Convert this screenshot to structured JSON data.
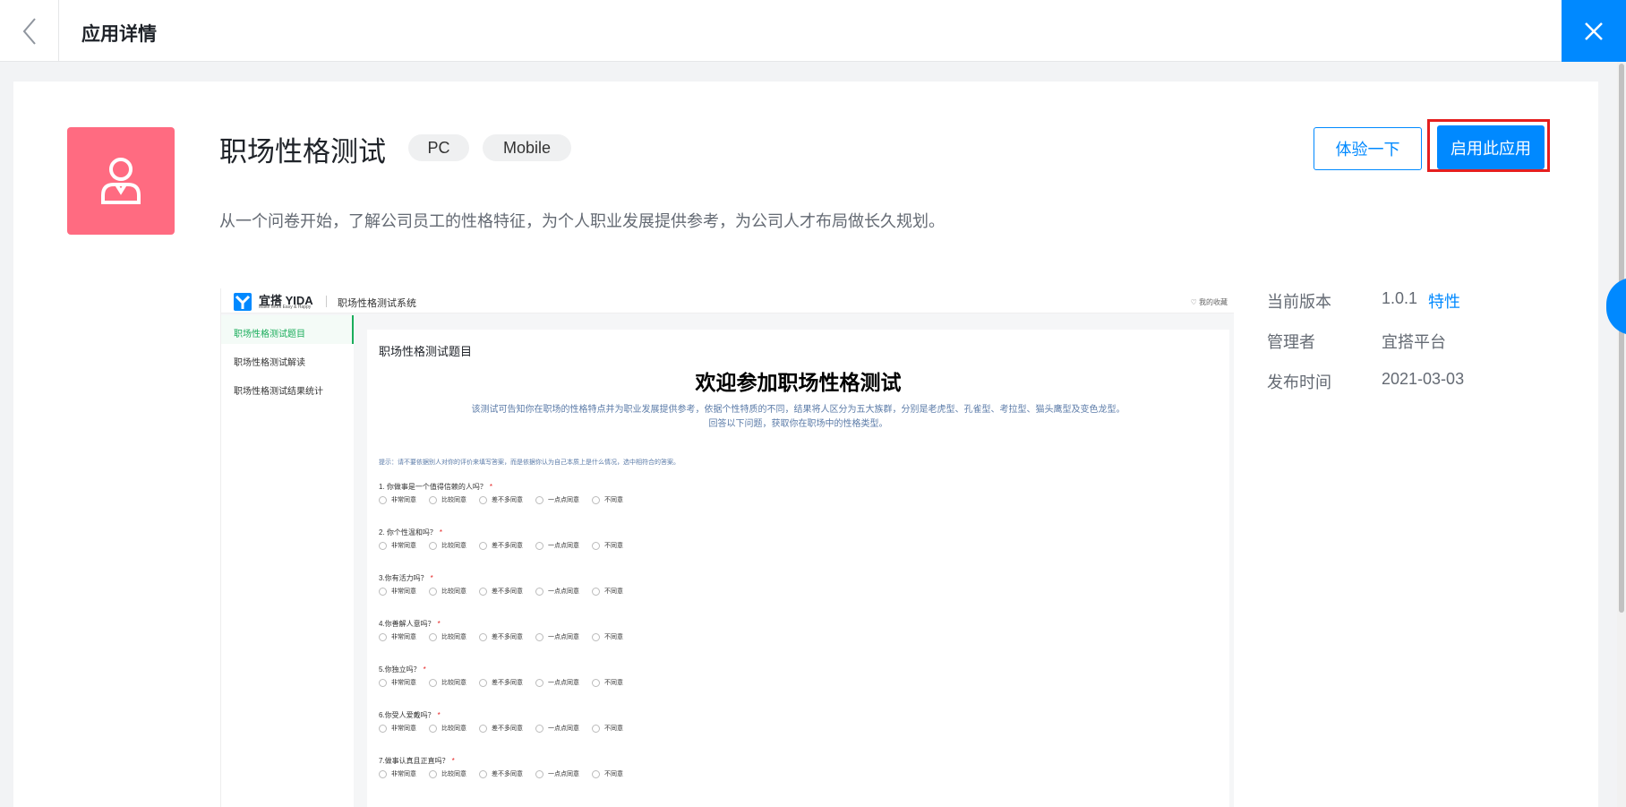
{
  "header": {
    "title": "应用详情"
  },
  "app": {
    "name": "职场性格测试",
    "tags": [
      "PC",
      "Mobile"
    ],
    "description": "从一个问卷开始，了解公司员工的性格特征，为个人职业发展提供参考，为公司人才布局做长久规划。",
    "icon_name": "user-icon",
    "icon_color": "#ff6b81"
  },
  "actions": {
    "try_label": "体验一下",
    "enable_label": "启用此应用"
  },
  "meta": {
    "version_label": "当前版本",
    "version_value": "1.0.1",
    "features_link": "特性",
    "admin_label": "管理者",
    "admin_value": "宜搭平台",
    "publish_label": "发布时间",
    "publish_value": "2021-03-03"
  },
  "preview": {
    "brand": "宜搭 YIDA",
    "slogan": "Make Work Easy & Happy",
    "system_name": "职场性格测试系统",
    "favorites": "♡ 我的收藏",
    "sidebar": [
      "职场性格测试题目",
      "职场性格测试解读",
      "职场性格测试结果统计"
    ],
    "form_title": "职场性格测试题目",
    "welcome": "欢迎参加职场性格测试",
    "intro_line1": "该测试可告知你在职场的性格特点并为职业发展提供参考，依据个性特质的不同，结果将人区分为五大族群，分别是老虎型、孔雀型、考拉型、猫头鹰型及变色龙型。",
    "intro_line2": "回答以下问题，获取你在职场中的性格类型。",
    "hint": "提示：请不要依据别人对你的评价来填写答案，而是依据你认为自己本质上是什么情况，选中相符合的答案。",
    "options": [
      "非常同意",
      "比较同意",
      "差不多同意",
      "一点点同意",
      "不同意"
    ],
    "questions": [
      "1. 你做事是一个值得信赖的人吗？",
      "2. 你个性温和吗？",
      "3.你有活力吗？",
      "4.你善解人意吗？",
      "5.你独立吗？",
      "6.你受人爱戴吗？",
      "7.做事认真且正直吗？"
    ]
  },
  "colors": {
    "accent": "#0089ff",
    "highlight_frame": "#e51f1f",
    "preview_active": "#1aad5b"
  }
}
